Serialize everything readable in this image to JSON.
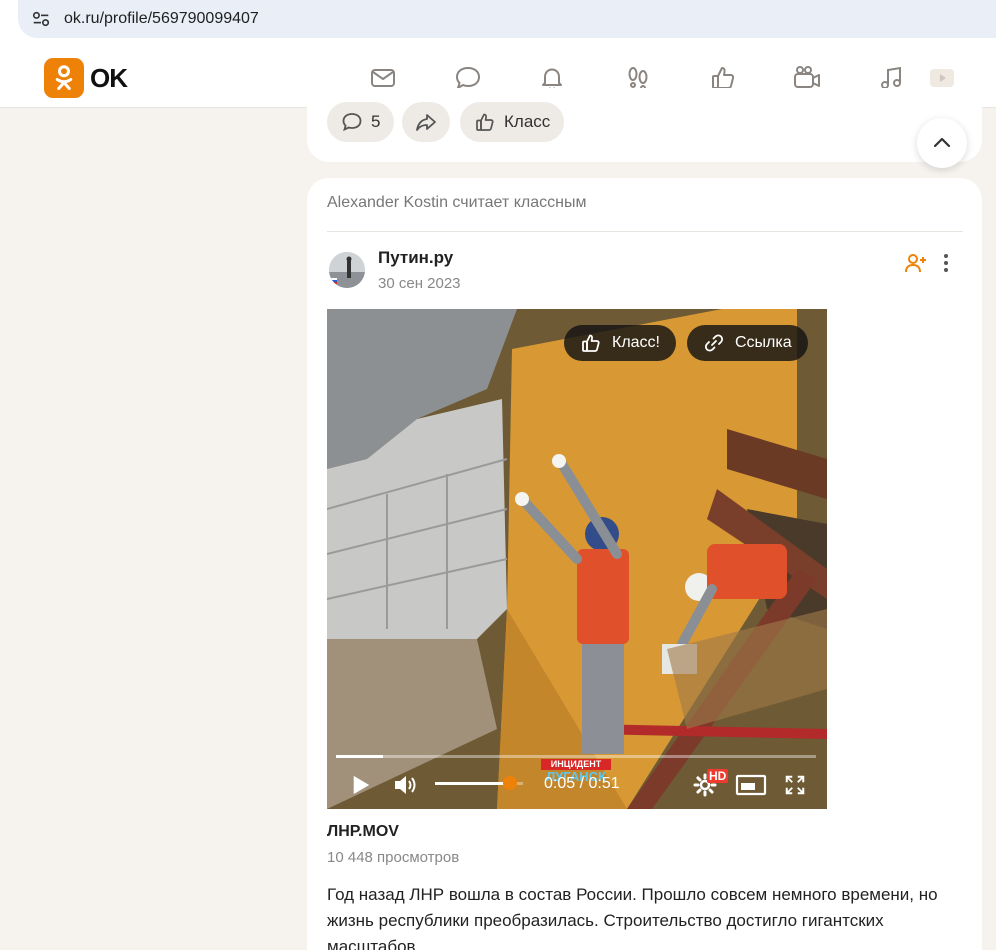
{
  "browser": {
    "url": "ok.ru/profile/569790099407"
  },
  "header": {
    "logo_text": "OK",
    "nav": [
      "mail-icon",
      "chat-icon",
      "bell-icon",
      "footprints-icon",
      "like-icon",
      "video-camera-icon",
      "music-icon",
      "video-play-icon"
    ]
  },
  "top_card": {
    "comments_count": "5",
    "like_label": "Класс"
  },
  "post": {
    "liked_by": "Alexander Kostin считает классным",
    "author": "Путин.ру",
    "date": "30 сен 2023",
    "video": {
      "like_button": "Класс!",
      "link_button": "Ссылка",
      "time": "0:05 / 0:51",
      "progress": 0.098,
      "volume": 0.85,
      "hd": "HD",
      "watermark_top": "ИНЦИДЕНТ",
      "watermark_bottom": "ЛУГАНСК"
    },
    "title": "ЛНР.MOV",
    "views": "10 448 просмотров",
    "text": "Год назад ЛНР вошла в состав России. Прошло совсем немного времени, но жизнь республики преобразилась. Строительство достигло гигантских масштабов."
  },
  "colors": {
    "accent": "#ee8208",
    "background": "#f6f3ef",
    "card": "#ffffff"
  }
}
